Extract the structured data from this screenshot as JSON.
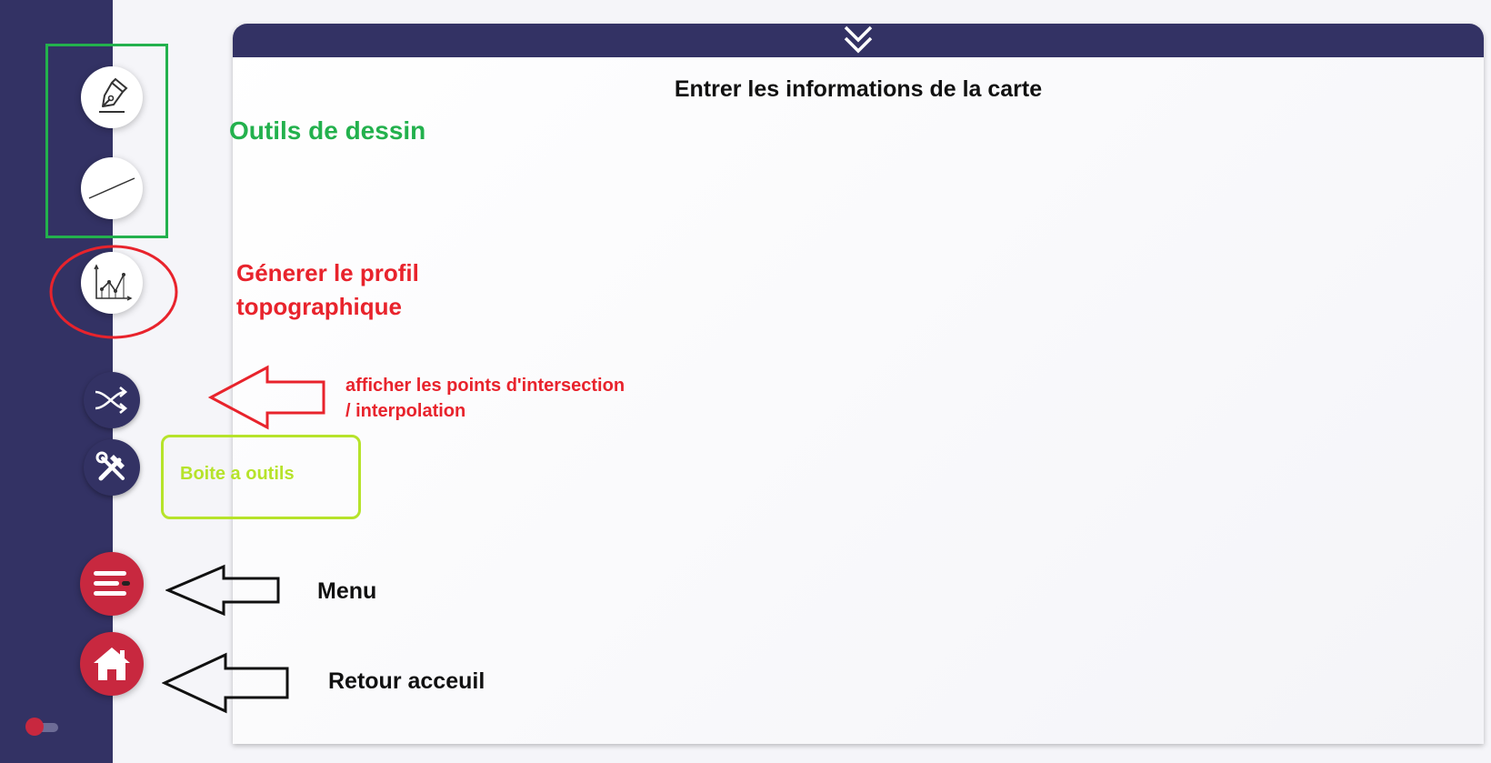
{
  "card": {
    "title": "Entrer les informations de la carte"
  },
  "sidebar": {
    "buttons": [
      {
        "name": "draw-freehand",
        "icon": "pen-nib-icon"
      },
      {
        "name": "draw-line",
        "icon": "line-icon"
      },
      {
        "name": "topographic-profile",
        "icon": "line-chart-icon"
      },
      {
        "name": "intersection-interpolation",
        "icon": "shuffle-icon"
      },
      {
        "name": "toolbox",
        "icon": "tools-icon"
      },
      {
        "name": "menu",
        "icon": "menu-icon"
      },
      {
        "name": "home",
        "icon": "home-icon"
      }
    ]
  },
  "annotations": {
    "drawing_tools": "Outils de dessin",
    "profile_line1": "Génerer le profil",
    "profile_line2": "topographique",
    "intersection_line1": "afficher les points d'intersection",
    "intersection_line2": "/ interpolation",
    "toolbox": "Boite a outils",
    "menu": "Menu",
    "home": "Retour acceuil"
  },
  "colors": {
    "navy": "#333264",
    "accent_red": "#c8283f",
    "annotation_green": "#23b14d",
    "annotation_red": "#e8232c",
    "annotation_lime": "#b6e32a"
  }
}
